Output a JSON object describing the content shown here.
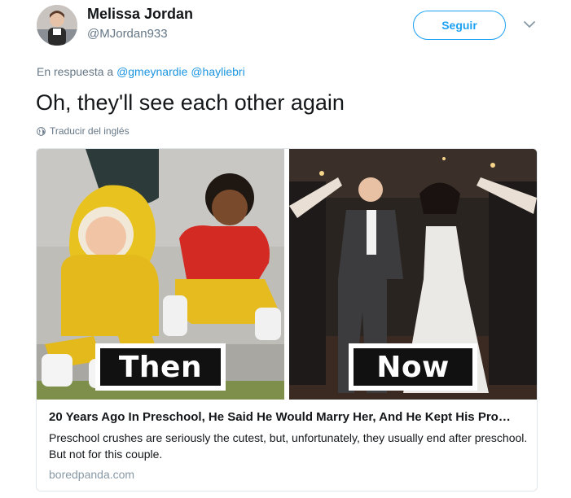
{
  "author": {
    "name": "Melissa Jordan",
    "handle": "@MJordan933"
  },
  "follow_button": {
    "label": "Seguir"
  },
  "reply": {
    "prefix": "En respuesta a",
    "mentions": [
      "@gmeynardie",
      "@hayliebri"
    ]
  },
  "tweet": {
    "text": "Oh, they'll see each other again",
    "translate_label": "Traducir del inglés"
  },
  "card": {
    "image_labels": {
      "left": "Then",
      "right": "Now"
    },
    "title": "20 Years Ago In Preschool, He Said He Would Marry Her, And He Kept His Pro…",
    "description": "Preschool crushes are seriously the cutest, but, unfortunately, they usually end after preschool. But not for this couple.",
    "domain": "boredpanda.com"
  },
  "colors": {
    "brand_blue": "#1da1f2",
    "link_blue": "#1b95e0",
    "secondary_text": "#657786",
    "border": "#e1e8ed"
  },
  "icons": {
    "menu": "chevron-down-icon",
    "translate": "globe-icon"
  }
}
